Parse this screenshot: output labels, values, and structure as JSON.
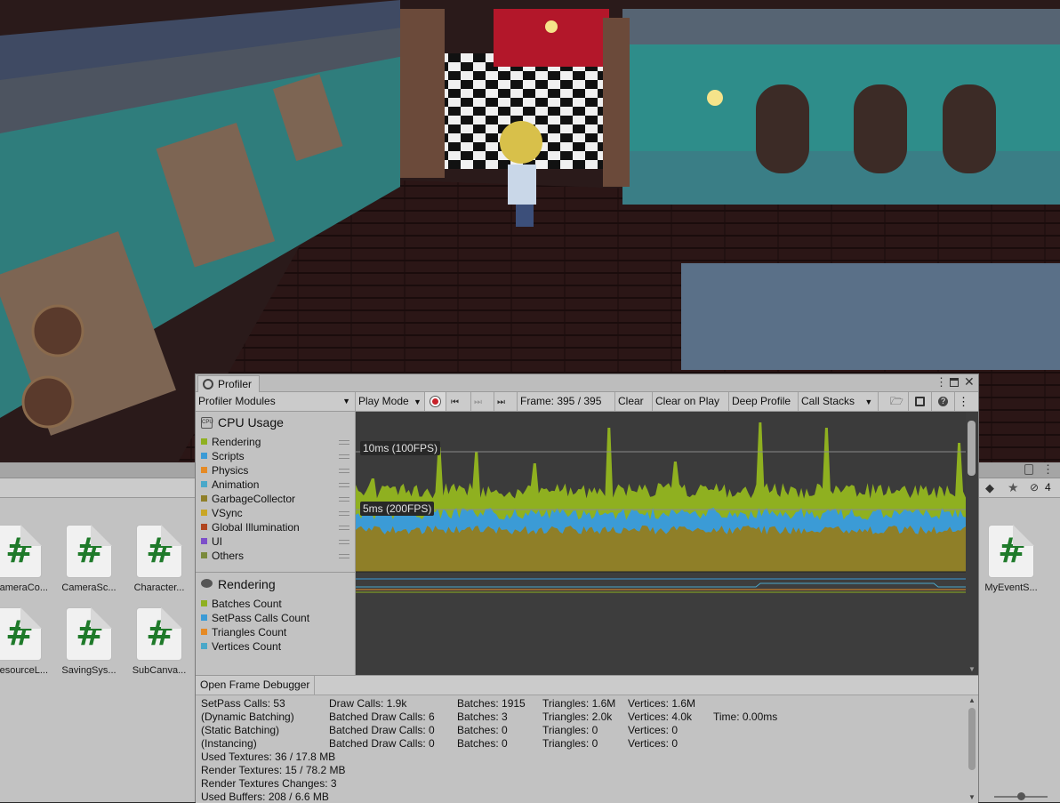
{
  "profiler": {
    "tab_title": "Profiler",
    "toolbar": {
      "modules_dropdown": "Profiler Modules",
      "play_mode": "Play Mode",
      "frame": "Frame: 395 / 395",
      "clear": "Clear",
      "clear_on_play": "Clear on Play",
      "deep_profile": "Deep Profile",
      "call_stacks": "Call Stacks"
    },
    "cpu_module": {
      "title": "CPU Usage",
      "icon_text": "CPU",
      "items": [
        {
          "label": "Rendering",
          "color": "#8fb020"
        },
        {
          "label": "Scripts",
          "color": "#3b9bd6"
        },
        {
          "label": "Physics",
          "color": "#e58a25"
        },
        {
          "label": "Animation",
          "color": "#4aa8c9"
        },
        {
          "label": "GarbageCollector",
          "color": "#8f7f28"
        },
        {
          "label": "VSync",
          "color": "#c9a625"
        },
        {
          "label": "Global Illumination",
          "color": "#b0451f"
        },
        {
          "label": "UI",
          "color": "#7d4fc9"
        },
        {
          "label": "Others",
          "color": "#7a8a3b"
        }
      ],
      "marker_10ms": "10ms (100FPS)",
      "marker_5ms": "5ms (200FPS)"
    },
    "rendering_module": {
      "title": "Rendering",
      "items": [
        {
          "label": "Batches Count",
          "color": "#8fb020"
        },
        {
          "label": "SetPass Calls Count",
          "color": "#3b9bd6"
        },
        {
          "label": "Triangles Count",
          "color": "#e58a25"
        },
        {
          "label": "Vertices Count",
          "color": "#4aa8c9"
        }
      ]
    },
    "details": {
      "open_frame_debugger": "Open Frame Debugger",
      "col1": [
        "SetPass Calls: 53",
        "(Dynamic Batching)",
        "(Static Batching)",
        "(Instancing)",
        "Used Textures: 36 / 17.8 MB",
        "Render Textures: 15 / 78.2 MB",
        "Render Textures Changes: 3",
        "Used Buffers: 208 / 6.6 MB"
      ],
      "col2": [
        "Draw Calls: 1.9k",
        "Batched Draw Calls: 6",
        "Batched Draw Calls: 0",
        "Batched Draw Calls: 0"
      ],
      "col3": [
        "Batches: 1915",
        "Batches: 3",
        "Batches: 0",
        "Batches: 0"
      ],
      "col4": [
        "Triangles: 1.6M",
        "Triangles: 2.0k",
        "Triangles: 0",
        "Triangles: 0"
      ],
      "col5": [
        "Vertices: 1.6M",
        "Vertices: 4.0k",
        "Vertices: 0",
        "Vertices: 0"
      ],
      "col6": [
        "",
        "Time: 0.00ms",
        "",
        ""
      ]
    }
  },
  "project": {
    "hidden_count": "4",
    "assets_left": [
      "ameraCo...",
      "CameraSc...",
      "Character...",
      "esourceL...",
      "SavingSys...",
      "SubCanva..."
    ],
    "asset_right": "MyEventS..."
  }
}
